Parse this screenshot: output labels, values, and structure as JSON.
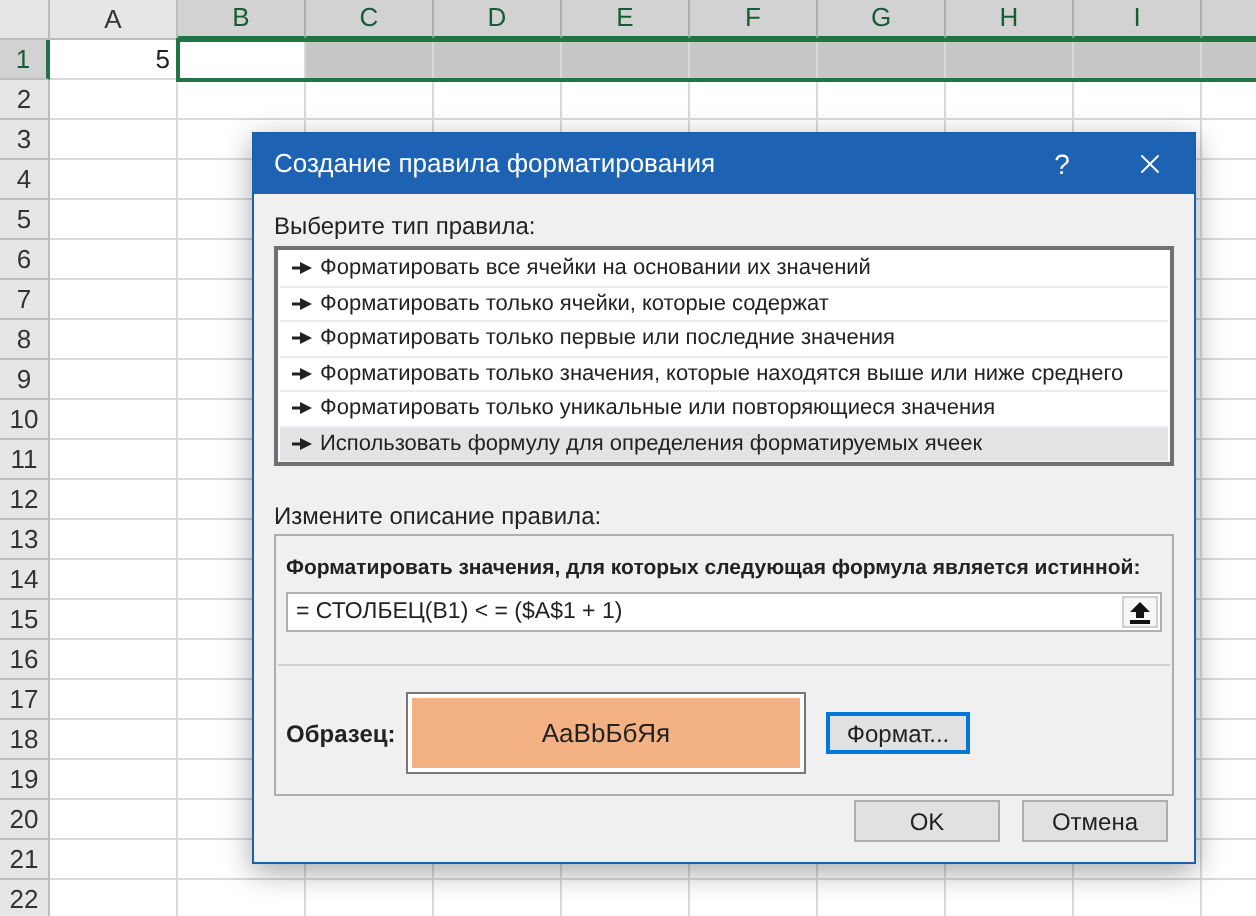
{
  "sheet": {
    "columns": [
      {
        "label": "A",
        "selected": false
      },
      {
        "label": "B",
        "selected": true
      },
      {
        "label": "C",
        "selected": true
      },
      {
        "label": "D",
        "selected": true
      },
      {
        "label": "E",
        "selected": true
      },
      {
        "label": "F",
        "selected": true
      },
      {
        "label": "G",
        "selected": true
      },
      {
        "label": "H",
        "selected": true
      },
      {
        "label": "I",
        "selected": true
      }
    ],
    "rows": [
      {
        "label": "1",
        "selected": true
      },
      {
        "label": "2",
        "selected": false
      },
      {
        "label": "3",
        "selected": false
      },
      {
        "label": "4",
        "selected": false
      },
      {
        "label": "5",
        "selected": false
      },
      {
        "label": "6",
        "selected": false
      },
      {
        "label": "7",
        "selected": false
      },
      {
        "label": "8",
        "selected": false
      },
      {
        "label": "9",
        "selected": false
      },
      {
        "label": "10",
        "selected": false
      },
      {
        "label": "11",
        "selected": false
      },
      {
        "label": "12",
        "selected": false
      },
      {
        "label": "13",
        "selected": false
      },
      {
        "label": "14",
        "selected": false
      },
      {
        "label": "15",
        "selected": false
      },
      {
        "label": "16",
        "selected": false
      },
      {
        "label": "17",
        "selected": false
      },
      {
        "label": "18",
        "selected": false
      },
      {
        "label": "19",
        "selected": false
      },
      {
        "label": "20",
        "selected": false
      },
      {
        "label": "21",
        "selected": false
      },
      {
        "label": "22",
        "selected": false
      }
    ],
    "cell_a1": "5"
  },
  "dialog": {
    "title": "Создание правила форматирования",
    "help": "?",
    "rule_type_label": "Выберите тип правила:",
    "rule_types": [
      {
        "label": "Форматировать все ячейки на основании их значений",
        "selected": false
      },
      {
        "label": "Форматировать только ячейки, которые содержат",
        "selected": false
      },
      {
        "label": "Форматировать только первые или последние значения",
        "selected": false
      },
      {
        "label": "Форматировать только значения, которые находятся выше или ниже среднего",
        "selected": false
      },
      {
        "label": "Форматировать только уникальные или повторяющиеся значения",
        "selected": false
      },
      {
        "label": "Использовать формулу для определения форматируемых ячеек",
        "selected": true
      }
    ],
    "description_label": "Измените описание правила:",
    "formula_label": "Форматировать значения, для которых следующая формула является истинной:",
    "formula": "= СТОЛБЕЦ(B1) < = ($A$1 + 1)",
    "preview_label": "Образец:",
    "preview": {
      "text": "AaBbБбЯя",
      "color": "#f4b183"
    },
    "format_button": "Формат...",
    "buttons": [
      "OK",
      "Отмена"
    ]
  }
}
